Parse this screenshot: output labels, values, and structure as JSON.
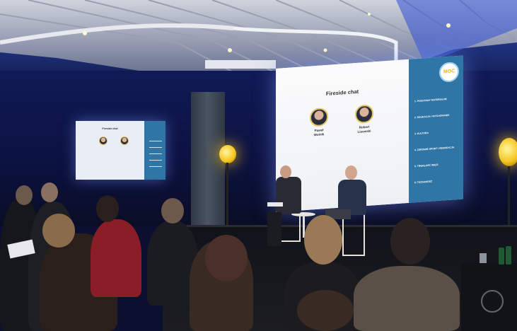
{
  "screen_big": {
    "title": "Fireside chat",
    "speakers": [
      {
        "first": "Paweł",
        "last": "Wolnik",
        "role": "..."
      },
      {
        "first": "Robert",
        "last": "Lisowski",
        "role": "..."
      }
    ],
    "agenda": [
      "1. PODSTAWY MATERIALNE",
      "2. EDUKACJA I WYCHOWANIE",
      "3. KULTURA",
      "4. ZDROWIE SPORT I REKREACJA",
      "5. TRWAŁOŚĆ WIĘZI",
      "6. TOŻSAMOŚĆ"
    ],
    "logo": {
      "line1": "",
      "big": "MOC",
      "line2": ""
    }
  },
  "screen_small": {
    "title": "Fireside chat"
  },
  "colors": {
    "room": "#0b1030",
    "screen_panel": "#2f76a6",
    "lamp": "#f4c21b",
    "chair": "#e6e2da"
  }
}
